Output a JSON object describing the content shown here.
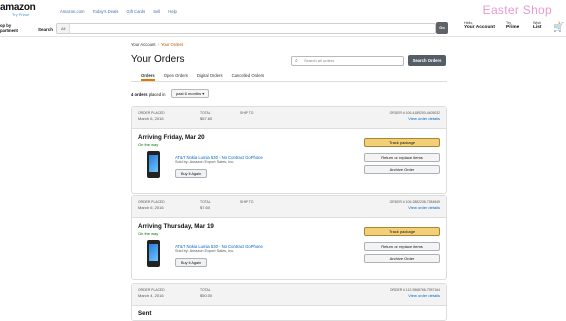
{
  "header": {
    "logo": "amazon",
    "logo_sub": "Try Prime",
    "nav": [
      "Amazon.com",
      "Today's Deals",
      "Gift Cards",
      "Sell",
      "Help"
    ],
    "promo": "Easter Shop",
    "dept_line1": "op by",
    "dept_line2": "partment",
    "search_label": "Search",
    "search_category": "All",
    "go_label": "Go",
    "account_top": "Hello,",
    "account_bottom": "Your Account",
    "prime_top": "Try",
    "prime_bottom": "Prime",
    "wish_top": "Wish",
    "wish_bottom": "List",
    "cart_count": "1"
  },
  "page": {
    "crumb_account": "Your Account",
    "crumb_sep": "›",
    "crumb_current": "Your Orders",
    "title": "Your Orders",
    "search_placeholder": "Search all orders",
    "search_button": "Search Orders",
    "tabs": [
      "Orders",
      "Open Orders",
      "Digital Orders",
      "Cancelled Orders"
    ],
    "orders_count_num": "4 orders",
    "orders_count_text": "placed in",
    "period": "past 6 months"
  },
  "orders": [
    {
      "placed_label": "ORDER PLACED",
      "placed": "March 6, 2016",
      "total_label": "TOTAL",
      "total": "$57.60",
      "ship_label": "SHIP TO",
      "order_num": "ORDER # 106-4189200-4405032",
      "details": "View order details",
      "arrive": "Arriving Friday, Mar 20",
      "status": "On the way",
      "item": "AT&T Nokia Lumia 530 - No Contract GoPhone",
      "seller": "Sold by: Amazon Export Sales, Inc.",
      "buy_again": "Buy it Again",
      "track": "Track package",
      "return": "Return or replace items",
      "archive": "Archive Order"
    },
    {
      "placed_label": "ORDER PLACED",
      "placed": "March 6, 2016",
      "total_label": "TOTAL",
      "total": "$7.60",
      "ship_label": "SHIP TO",
      "order_num": "ORDER # 106-2882238-7284849",
      "details": "View order details",
      "arrive": "Arriving Thursday, Mar 19",
      "status": "On the way",
      "item": "AT&T Nokia Lumia 530 - No Contract GoPhone",
      "seller": "Sold by: Amazon Export Sales, Inc.",
      "buy_again": "Buy it Again",
      "track": "Track package",
      "return": "Return or replace items",
      "archive": "Archive Order"
    },
    {
      "placed_label": "ORDER PLACED",
      "placed": "March 4, 2016",
      "total_label": "TOTAL",
      "total": "$50.00",
      "ship_label": "",
      "order_num": "ORDER # 112-9568766-7957164",
      "details": "View order details",
      "arrive": "Sent"
    }
  ]
}
